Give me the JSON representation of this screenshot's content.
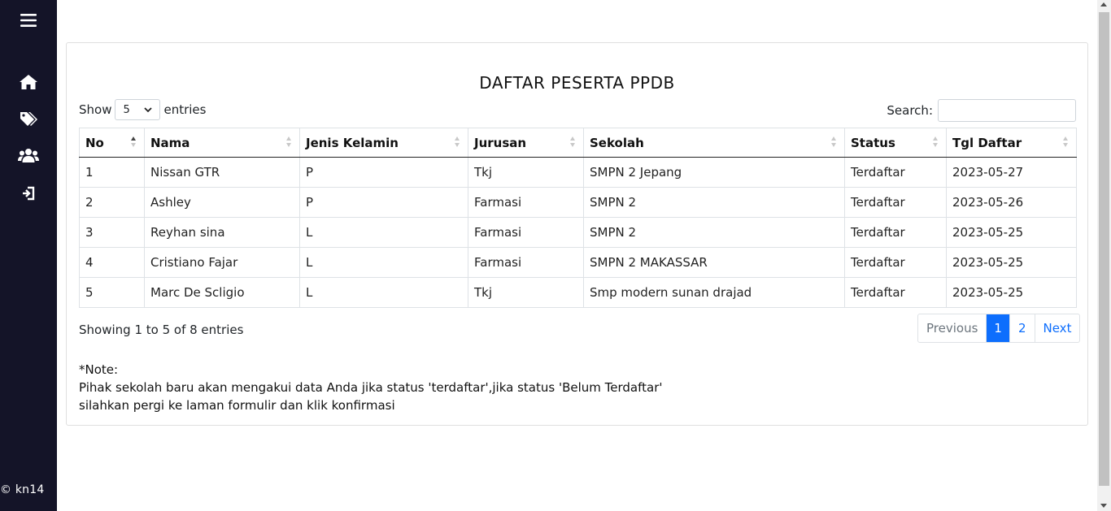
{
  "sidebar": {
    "icons": [
      "menu-icon",
      "home-icon",
      "tags-icon",
      "users-icon",
      "logout-icon"
    ],
    "copyright": "© kn14",
    "bg_color": "#141428"
  },
  "card": {
    "title": "DAFTAR PESERTA PPDB",
    "length": {
      "show_label": "Show",
      "value": "5",
      "entries_label": "entries"
    },
    "search": {
      "label": "Search:",
      "value": ""
    },
    "columns": [
      "No",
      "Nama",
      "Jenis Kelamin",
      "Jurusan",
      "Sekolah",
      "Status",
      "Tgl Daftar"
    ],
    "rows": [
      [
        "1",
        "Nissan GTR",
        "P",
        "Tkj",
        "SMPN 2 Jepang",
        "Terdaftar",
        "2023-05-27"
      ],
      [
        "2",
        "Ashley",
        "P",
        "Farmasi",
        "SMPN 2",
        "Terdaftar",
        "2023-05-26"
      ],
      [
        "3",
        "Reyhan sina",
        "L",
        "Farmasi",
        "SMPN 2",
        "Terdaftar",
        "2023-05-25"
      ],
      [
        "4",
        "Cristiano Fajar",
        "L",
        "Farmasi",
        "SMPN 2 MAKASSAR",
        "Terdaftar",
        "2023-05-25"
      ],
      [
        "5",
        "Marc De Scligio",
        "L",
        "Tkj",
        "Smp modern sunan drajad",
        "Terdaftar",
        "2023-05-25"
      ]
    ],
    "info": "Showing 1 to 5 of 8 entries",
    "pagination": {
      "previous": "Previous",
      "pages": [
        "1",
        "2"
      ],
      "active": "1",
      "next": "Next"
    },
    "note": {
      "heading": "*Note:",
      "line1": "Pihak sekolah baru akan mengakui data Anda jika status 'terdaftar',jika status 'Belum Terdaftar'",
      "line2": "silahkan pergi ke laman formulir dan klik konfirmasi"
    },
    "accent_color": "#0d6efd"
  }
}
